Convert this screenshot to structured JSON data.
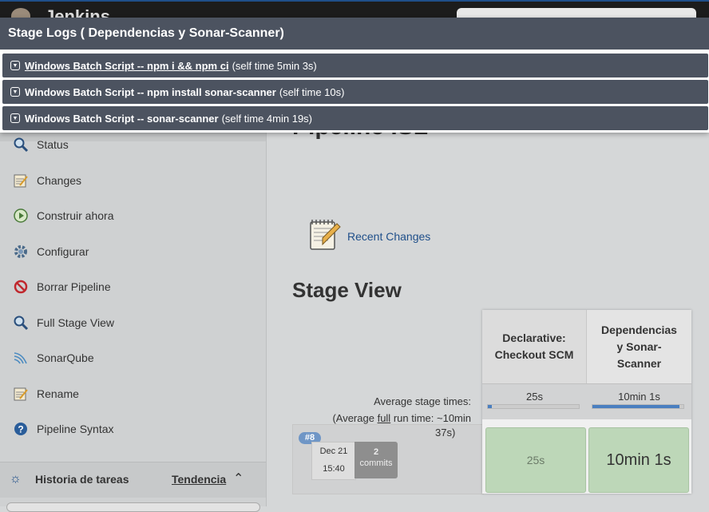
{
  "header": {
    "brand": "Jenkins"
  },
  "sidebar": {
    "items": [
      {
        "label": "Status",
        "icon": "magnifier-icon"
      },
      {
        "label": "Changes",
        "icon": "notepad-icon"
      },
      {
        "label": "Construir ahora",
        "icon": "build-clock-icon"
      },
      {
        "label": "Configurar",
        "icon": "gear-icon"
      },
      {
        "label": "Borrar Pipeline",
        "icon": "no-entry-icon"
      },
      {
        "label": "Full Stage View",
        "icon": "magnifier-icon"
      },
      {
        "label": "SonarQube",
        "icon": "sonar-waves-icon"
      },
      {
        "label": "Rename",
        "icon": "notepad-icon"
      },
      {
        "label": "Pipeline Syntax",
        "icon": "help-circle-icon"
      }
    ],
    "history": {
      "title": "Historia de tareas",
      "trend": "Tendencia"
    }
  },
  "main": {
    "title": "Pipeline ISL",
    "recent_changes": "Recent Changes",
    "stage_view": "Stage View",
    "avg_stage_times": "Average stage times:",
    "avg_run_prefix": "(Average ",
    "avg_run_full": "full",
    "avg_run_suffix": " run time: ~10min",
    "avg_run_tail": "37s)",
    "stages": [
      {
        "name": "Declarative: Checkout SCM",
        "avg": "25s",
        "avg_fraction": 0.04,
        "cell": "25s"
      },
      {
        "name": "Dependencias y Sonar-Scanner",
        "avg": "10min 1s",
        "avg_fraction": 0.96,
        "cell": "10min 1s"
      }
    ],
    "run": {
      "badge": "#8",
      "date": "Dec 21",
      "time": "15:40",
      "commits_count": "2",
      "commits_label": "commits"
    }
  },
  "modal": {
    "title": "Stage Logs ( Dependencias y Sonar-Scanner)",
    "logs": [
      {
        "label": "Windows Batch Script -- npm i && npm ci",
        "time": "(self time 5min 3s)"
      },
      {
        "label": "Windows Batch Script -- npm install sonar-scanner",
        "time": "(self time 10s)"
      },
      {
        "label": "Windows Batch Script -- sonar-scanner",
        "time": "(self time 4min 19s)"
      }
    ]
  },
  "colors": {
    "modal_header": "#4c5360",
    "link": "#1f4f8a",
    "success_cell": "#bdd7b8",
    "progress": "#4a7fc0"
  }
}
